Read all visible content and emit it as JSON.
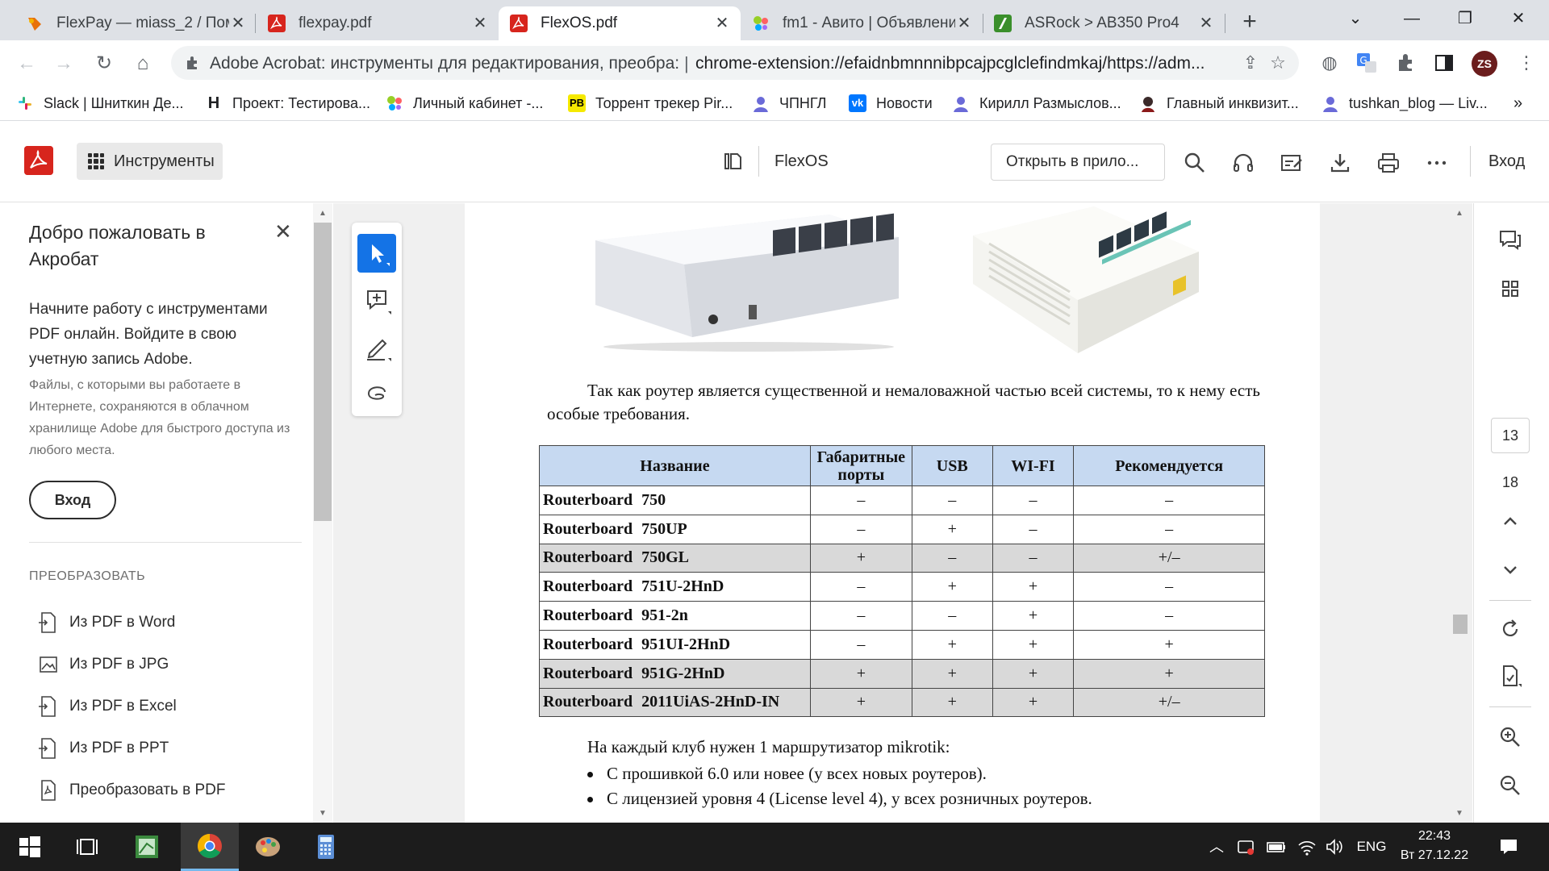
{
  "browser": {
    "tabs": [
      {
        "title": "FlexPay — miass_2 / Пом",
        "icon": "figma-like-icon",
        "color": "#e8710a",
        "active": false
      },
      {
        "title": "flexpay.pdf",
        "icon": "pdf-icon",
        "color": "#d7251d",
        "active": false
      },
      {
        "title": "FlexOS.pdf",
        "icon": "pdf-icon",
        "color": "#d7251d",
        "active": true
      },
      {
        "title": "fm1 - Авито | Объявлени",
        "icon": "avito-icon",
        "color": "#00aaff",
        "active": false
      },
      {
        "title": "ASRock > AB350 Pro4",
        "icon": "asrock-icon",
        "color": "#3a8f2b",
        "active": false
      }
    ],
    "omnibox": {
      "page_title": "Adobe Acrobat: инструменты для редактирования, преобра:",
      "separator": "|",
      "url": "chrome-extension://efaidnbmnnnibpcajpcglclefindmkaj/https://adm..."
    },
    "profile_initials": "ZS",
    "bookmarks": [
      {
        "label": "Slack | Шниткин Де...",
        "icon": "slack-icon"
      },
      {
        "label": "Проект: Тестирова...",
        "icon": "project-icon"
      },
      {
        "label": "Личный кабинет -...",
        "icon": "dots-icon"
      },
      {
        "label": "Торрент трекер Pir...",
        "icon": "pb-icon"
      },
      {
        "label": "ЧПНГЛ",
        "icon": "person-icon"
      },
      {
        "label": "Новости",
        "icon": "vk-icon"
      },
      {
        "label": "Кирилл Размыслов...",
        "icon": "person-icon"
      },
      {
        "label": "Главный инквизит...",
        "icon": "inquisitor-icon"
      },
      {
        "label": "tushkan_blog — Liv...",
        "icon": "person-icon"
      }
    ],
    "bookmarks_more": "»"
  },
  "acrobat": {
    "tools_label": "Инструменты",
    "doc_name": "FlexOS",
    "open_in_app": "Открыть в прило...",
    "sign_in": "Вход"
  },
  "welcome": {
    "title": "Добро пожаловать в Акробат",
    "main_text": "Начните работу с инструментами PDF онлайн. Войдите в свою учетную запись Adobe.",
    "small_text": "Файлы, с которыми вы работаете в Интернете, сохраняются в облачном хранилище Adobe для быстрого доступа из любого места.",
    "sign_in_button": "Вход",
    "section_title": "ПРЕОБРАЗОВАТЬ",
    "items": [
      {
        "label": "Из PDF в Word"
      },
      {
        "label": "Из PDF в JPG"
      },
      {
        "label": "Из PDF в Excel"
      },
      {
        "label": "Из PDF в PPT"
      },
      {
        "label": "Преобразовать в PDF"
      }
    ]
  },
  "document": {
    "paragraph1": "Так как роутер является существенной и немаловажной частью всей системы, то к нему есть особые требования.",
    "table": {
      "headers": [
        "Название",
        "Габаритные порты",
        "USB",
        "WI-FI",
        "Рекомендуется"
      ],
      "rows": [
        {
          "name": "Routerboard  750",
          "ports": "–",
          "usb": "–",
          "wifi": "–",
          "rec": "–",
          "shaded": false
        },
        {
          "name": "Routerboard  750UP",
          "ports": "–",
          "usb": "+",
          "wifi": "–",
          "rec": "–",
          "shaded": false
        },
        {
          "name": "Routerboard  750GL",
          "ports": "+",
          "usb": "–",
          "wifi": "–",
          "rec": "+/–",
          "shaded": true
        },
        {
          "name": "Routerboard  751U-2HnD",
          "ports": "–",
          "usb": "+",
          "wifi": "+",
          "rec": "–",
          "shaded": false
        },
        {
          "name": "Routerboard  951-2n",
          "ports": "–",
          "usb": "–",
          "wifi": "+",
          "rec": "–",
          "shaded": false
        },
        {
          "name": "Routerboard  951UI-2HnD",
          "ports": "–",
          "usb": "+",
          "wifi": "+",
          "rec": "+",
          "shaded": false
        },
        {
          "name": "Routerboard  951G-2HnD",
          "ports": "+",
          "usb": "+",
          "wifi": "+",
          "rec": "+",
          "shaded": true
        },
        {
          "name": "Routerboard 2011UiAS-2HnD-IN",
          "ports": "+",
          "usb": "+",
          "wifi": "+",
          "rec": "+/–",
          "shaded": true
        }
      ]
    },
    "paragraph2": "На каждый клуб нужен 1 маршрутизатор mikrotik:",
    "bullets": [
      "С прошивкой 6.0 или новее (у всех новых роутеров).",
      "С лицензией уровня 4 (License level 4), у всех розничных роутеров."
    ]
  },
  "pager": {
    "current": "13",
    "total": "18"
  },
  "taskbar": {
    "language": "ENG",
    "time": "22:43",
    "date": "Вт 27.12.22"
  },
  "colors": {
    "acrobat_red": "#d7251d",
    "active_tool_blue": "#1473e6",
    "table_header": "#c6d9f1",
    "table_shade": "#d9d9d9"
  }
}
